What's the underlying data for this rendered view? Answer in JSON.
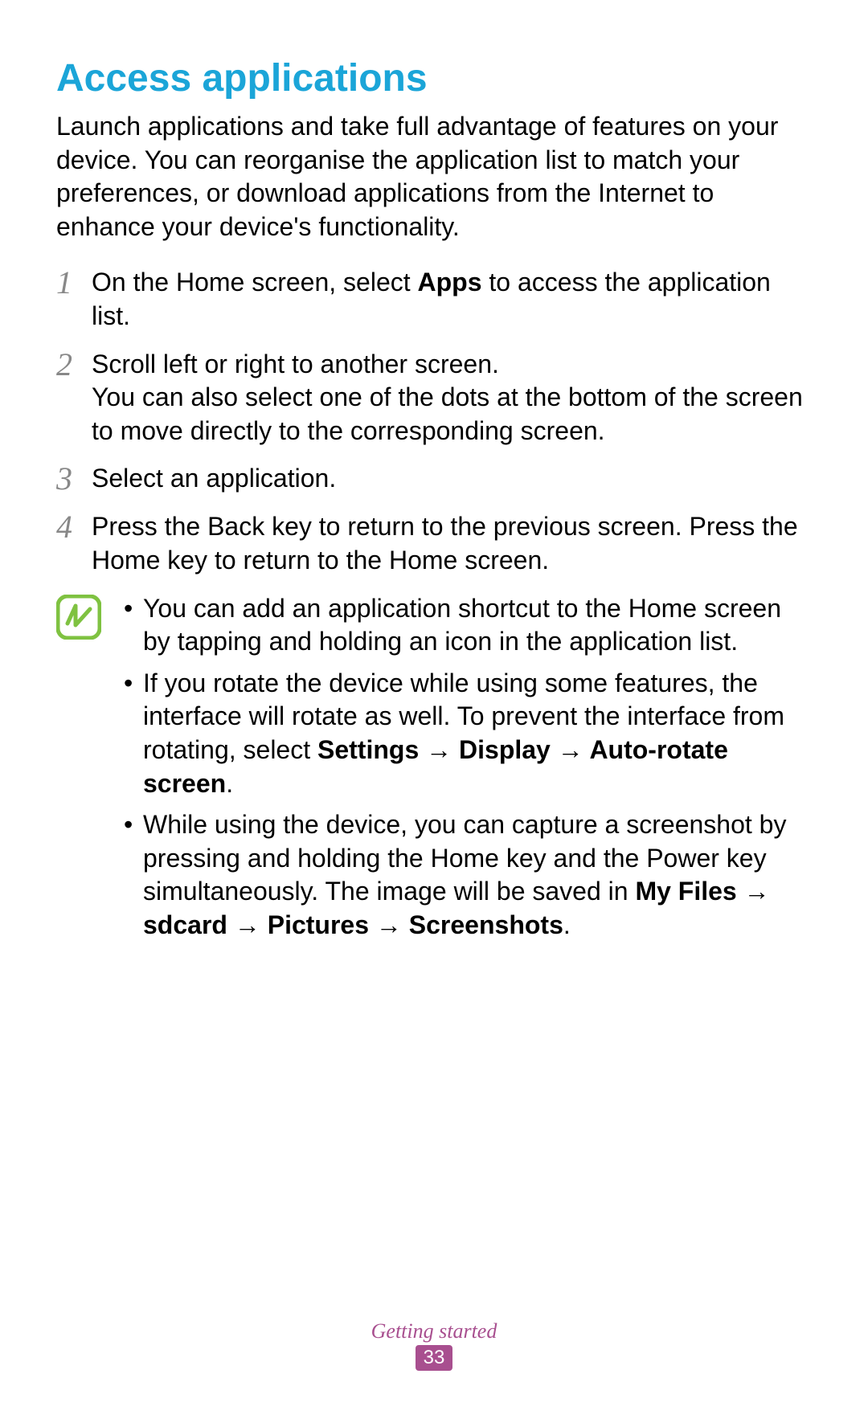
{
  "heading": "Access applications",
  "intro": "Launch applications and take full advantage of features on your device. You can reorganise the application list to match your preferences, or download applications from the Internet to enhance your device's functionality.",
  "steps": [
    {
      "num": "1",
      "pre": "On the Home screen, select ",
      "bold1": "Apps",
      "post": " to access the application list."
    },
    {
      "num": "2",
      "text": "Scroll left or right to another screen.\nYou can also select one of the dots at the bottom of the screen to move directly to the corresponding screen."
    },
    {
      "num": "3",
      "text": "Select an application."
    },
    {
      "num": "4",
      "text": "Press the Back key to return to the previous screen. Press the Home key to return to the Home screen."
    }
  ],
  "notes": [
    {
      "text": "You can add an application shortcut to the Home screen by tapping and holding an icon in the application list."
    },
    {
      "pre": "If you rotate the device while using some features, the interface will rotate as well. To prevent the interface from rotating, select ",
      "bold": "Settings → Display → Auto-rotate screen",
      "post": "."
    },
    {
      "pre": "While using the device, you can capture a screenshot by pressing and holding the Home key and the Power key simultaneously. The image will be saved in ",
      "bold": "My Files → sdcard → Pictures → Screenshots",
      "post": "."
    }
  ],
  "footer": {
    "section": "Getting started",
    "page": "33"
  }
}
